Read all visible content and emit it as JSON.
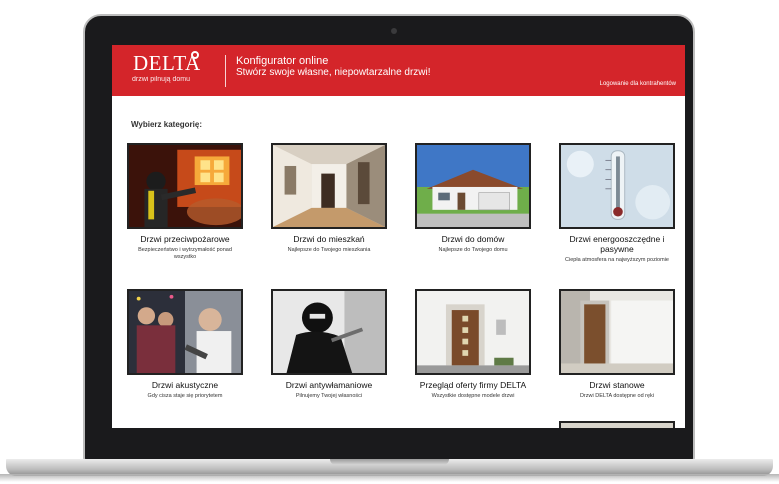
{
  "header": {
    "logo_text": "DELTA",
    "tagline": "drzwi pilnują domu",
    "title": "Konfigurator online",
    "subtitle": "Stwórz swoje własne, niepowtarzalne drzwi!",
    "login_link": "Logowanie dla kontrahentów"
  },
  "main": {
    "section_title": "Wybierz kategorię:",
    "categories": [
      {
        "title": "Drzwi przeciwpożarowe",
        "desc": "Bezpieczeństwo i wytrzymałość ponad wszystko",
        "icon": "firefighter-image"
      },
      {
        "title": "Drzwi do mieszkań",
        "desc": "Najlepsze do Twojego mieszkania",
        "icon": "apartment-hallway-image"
      },
      {
        "title": "Drzwi do domów",
        "desc": "Najlepsze do Twojego domu",
        "icon": "house-image"
      },
      {
        "title": "Drzwi energooszczędne i pasywne",
        "desc": "Ciepła atmosfera na najwyższym poziomie",
        "icon": "frozen-thermometer-image"
      },
      {
        "title": "Drzwi akustyczne",
        "desc": "Gdy cisza staje się priorytetem",
        "icon": "party-noise-image"
      },
      {
        "title": "Drzwi antywłamaniowe",
        "desc": "Pilnujemy Twojej własności",
        "icon": "burglar-image"
      },
      {
        "title": "Przegląd oferty firmy DELTA",
        "desc": "Wszystkie dostępne modele drzwi",
        "icon": "front-door-image"
      },
      {
        "title": "Drzwi stanowe",
        "desc": "Drzwi DELTA dostępne od ręki",
        "icon": "interior-door-image"
      }
    ]
  },
  "colors": {
    "brand_red": "#d4252a",
    "laptop_bezel": "#1a1a1c"
  }
}
